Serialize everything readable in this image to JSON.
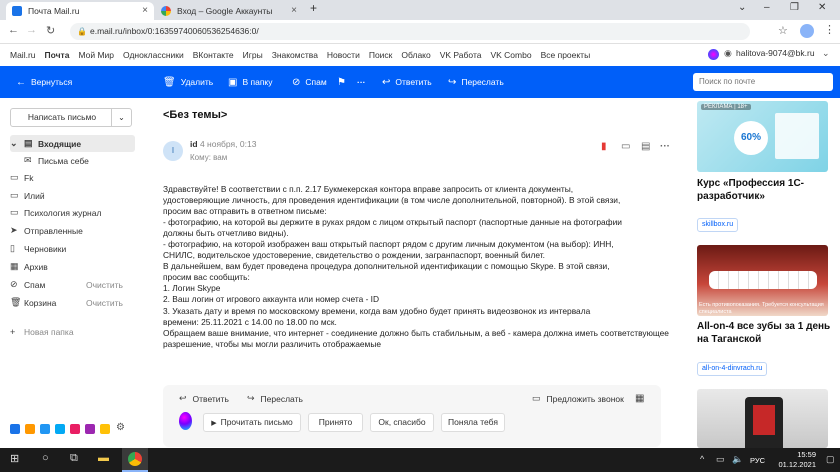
{
  "browser": {
    "tabs": [
      {
        "title": "Почта Mail.ru",
        "active": true
      },
      {
        "title": "Вход – Google Аккаунты",
        "active": false
      }
    ],
    "new_tab": "+",
    "url": "e.mail.ru/inbox/0:16359740060536254636:0/"
  },
  "portal_nav": [
    "Mail.ru",
    "Почта",
    "Мой Мир",
    "Одноклассники",
    "ВКонтакте",
    "Игры",
    "Знакомства",
    "Новости",
    "Поиск",
    "Облако",
    "VK Работа",
    "VK Combo",
    "Все проекты"
  ],
  "user_email": "halitova-9074@bk.ru",
  "toolbar": {
    "back": "Вернуться",
    "delete": "Удалить",
    "to_folder": "В папку",
    "spam": "Спам",
    "more": "···",
    "reply": "Ответить",
    "forward": "Переслать",
    "search_placeholder": "Поиск по почте"
  },
  "sidebar": {
    "compose": "Написать письмо",
    "folders": [
      {
        "label": "Входящие",
        "icon": "inbox-icon",
        "bold": true
      },
      {
        "label": "Письма себе",
        "icon": "mail-icon",
        "indent": true
      },
      {
        "label": "Fk",
        "icon": "folder-icon"
      },
      {
        "label": "Илий",
        "icon": "folder-icon"
      },
      {
        "label": "Психология журнал",
        "icon": "folder-icon"
      },
      {
        "label": "Отправленные",
        "icon": "sent-icon"
      },
      {
        "label": "Черновики",
        "icon": "draft-icon"
      },
      {
        "label": "Архив",
        "icon": "archive-icon"
      },
      {
        "label": "Спам",
        "icon": "spam-icon",
        "clear": "Очистить"
      },
      {
        "label": "Корзина",
        "icon": "trash-icon",
        "clear": "Очистить"
      }
    ],
    "new_folder": "Новая папка"
  },
  "mail": {
    "subject": "<Без темы>",
    "avatar_letter": "I",
    "sender": "id",
    "date": "4 ноября, 0:13",
    "to": "Кому: вам",
    "body_lines": [
      "Здравствуйте! В соответствии с п.п. 2.17 Букмекерская контора вправе запросить от клиента документы,",
      "удостоверяющие личность, для проведения идентификации (в том числе дополнительной, повторной). В этой связи,",
      "просим вас отправить в ответном письме:",
      "- фотографию, на которой вы держите в руках рядом с лицом открытый паспорт (паспортные данные на фотографии",
      "должны быть отчетливо видны).",
      "- фотографию, на которой изображен ваш открытый паспорт рядом с другим личным документом (на выбор): ИНН,",
      "СНИЛС, водительское удостоверение, свидетельство о рождении, загранпаспорт, военный билет.",
      "В дальнейшем, вам будет проведена процедура дополнительной идентификации с помощью Skype. В этой связи,",
      "просим вас сообщить:",
      "1. Логин Skype",
      "2. Ваш логин от игрового аккаунта или номер счета - ID",
      "3. Указать дату и время по московскому времени, когда вам удобно будет принять видеозвонок из интервала",
      "времени: 25.11.2021 с 14.00 по 18.00 по мск.",
      "Обращаем ваше внимание, что интернет - соединение должно быть стабильным, а веб - камера должна иметь соответствующее",
      "разрешение, чтобы мы могли различить отображаемые"
    ]
  },
  "reply_panel": {
    "reply": "Ответить",
    "forward": "Переслать",
    "video_call": "Предложить звонок",
    "quick": [
      "Прочитать письмо",
      "Принято",
      "Ок, спасибо",
      "Поняла тебя"
    ]
  },
  "ads": {
    "ad1_badge": "РЕКЛАМА | 18+",
    "ad1_title": "Курс «Профессия 1С-разработчик»",
    "ad1_link": "skillbox.ru",
    "ad1_percent": "60%",
    "ad2_caption": "Есть противопоказания. Требуется консультация специалиста",
    "ad2_title": "All-on-4 все зубы за 1 день на Таганской",
    "ad2_link": "all-on-4-dinvrach.ru"
  },
  "taskbar": {
    "lang": "РУС",
    "time": "15:59",
    "date": "01.12.2021"
  }
}
